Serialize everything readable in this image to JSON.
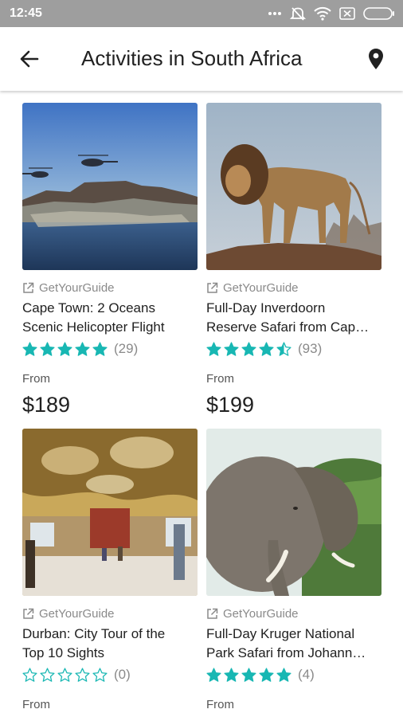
{
  "status_bar": {
    "time": "12:45",
    "icons": [
      "notification-dots-icon",
      "mute-icon",
      "wifi-icon",
      "sim-icon",
      "battery-icon"
    ]
  },
  "header": {
    "title": "Activities in South Africa",
    "back_icon": "arrow-back-icon",
    "location_icon": "location-pin-icon"
  },
  "theme": {
    "star_color": "#18b7b3",
    "status_bar_color": "#9e9e9e"
  },
  "activities": [
    {
      "provider": "GetYourGuide",
      "title_line1": "Cape Town: 2 Oceans",
      "title_line2": "Scenic Helicopter Flight",
      "rating": 5,
      "review_count": "(29)",
      "from_label": "From",
      "price": "$189",
      "image": "helicopters-over-cape-town"
    },
    {
      "provider": "GetYourGuide",
      "title_line1": "Full-Day Inverdoorn",
      "title_line2": "Reserve Safari from Cap…",
      "rating": 4.5,
      "review_count": "(93)",
      "from_label": "From",
      "price": "$199",
      "image": "lion-on-rock"
    },
    {
      "provider": "GetYourGuide",
      "title_line1": "Durban: City Tour of the",
      "title_line2": "Top 10 Sights",
      "rating": 0,
      "review_count": "(0)",
      "from_label": "From",
      "price": "",
      "image": "ornate-temple-interior"
    },
    {
      "provider": "GetYourGuide",
      "title_line1": "Full-Day Kruger National",
      "title_line2": "Park Safari from Johann…",
      "rating": 5,
      "review_count": "(4)",
      "from_label": "From",
      "price": "",
      "image": "elephant-in-bush"
    }
  ]
}
